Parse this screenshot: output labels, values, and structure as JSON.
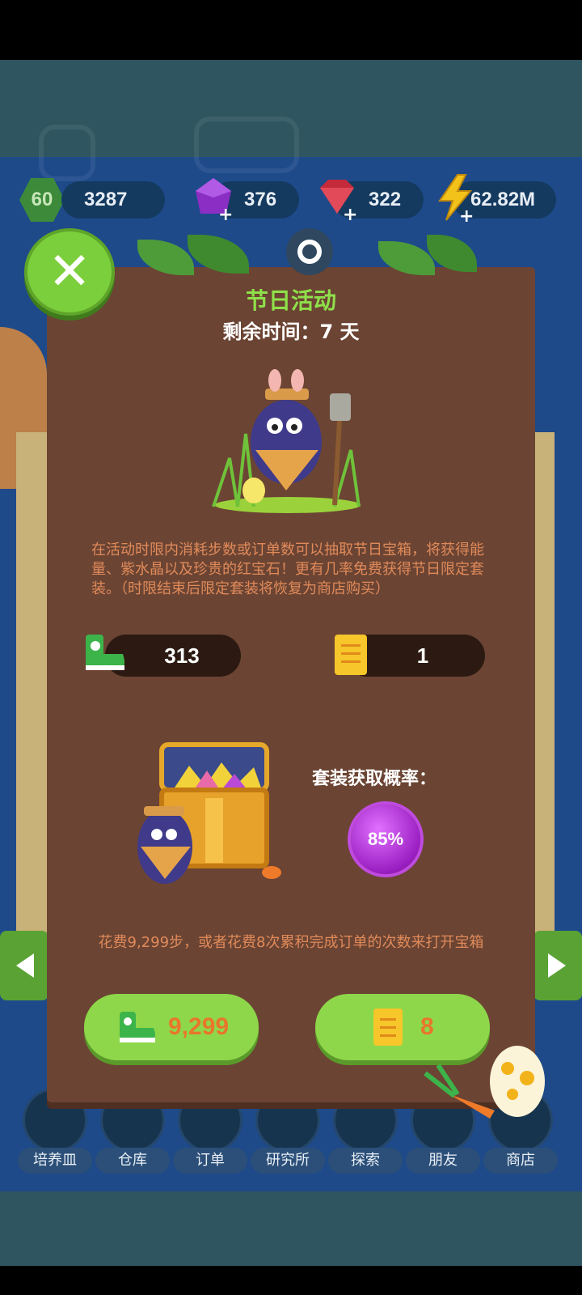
{
  "resources": {
    "level": "60",
    "steps": "3287",
    "amethyst": "376",
    "ruby": "322",
    "energy": "62.82M"
  },
  "modal": {
    "title": "节日活动",
    "subtitle": "剩余时间：7 天",
    "description": "在活动时限内消耗步数或订单数可以抽取节日宝箱，将获得能量、紫水晶以及珍贵的红宝石！更有几率免费获得节日限定套装。（时限结束后限定套装将恢复为商店购买）",
    "steps_owned": "313",
    "orders_owned": "1",
    "probability_label": "套装获取概率：",
    "probability_value": "85%",
    "cost_text": "花费9,299步，或者花费8次累积完成订单的次数来打开宝箱",
    "steps_cost": "9,299",
    "orders_cost": "8"
  },
  "nav": {
    "items": [
      {
        "label": "培养皿",
        "icon": "petri-dish-icon"
      },
      {
        "label": "仓库",
        "icon": "warehouse-icon"
      },
      {
        "label": "订单",
        "icon": "order-scroll-icon"
      },
      {
        "label": "研究所",
        "icon": "lab-icon"
      },
      {
        "label": "探索",
        "icon": "balloon-icon"
      },
      {
        "label": "朋友",
        "icon": "friends-icon"
      },
      {
        "label": "商店",
        "icon": "shop-icon"
      }
    ]
  },
  "colors": {
    "modal_bg": "#6b4433",
    "title_green": "#8fe04a",
    "button_green": "#8ed74a",
    "cost_orange": "#e8762c",
    "desc_orange": "#e08a5a"
  }
}
